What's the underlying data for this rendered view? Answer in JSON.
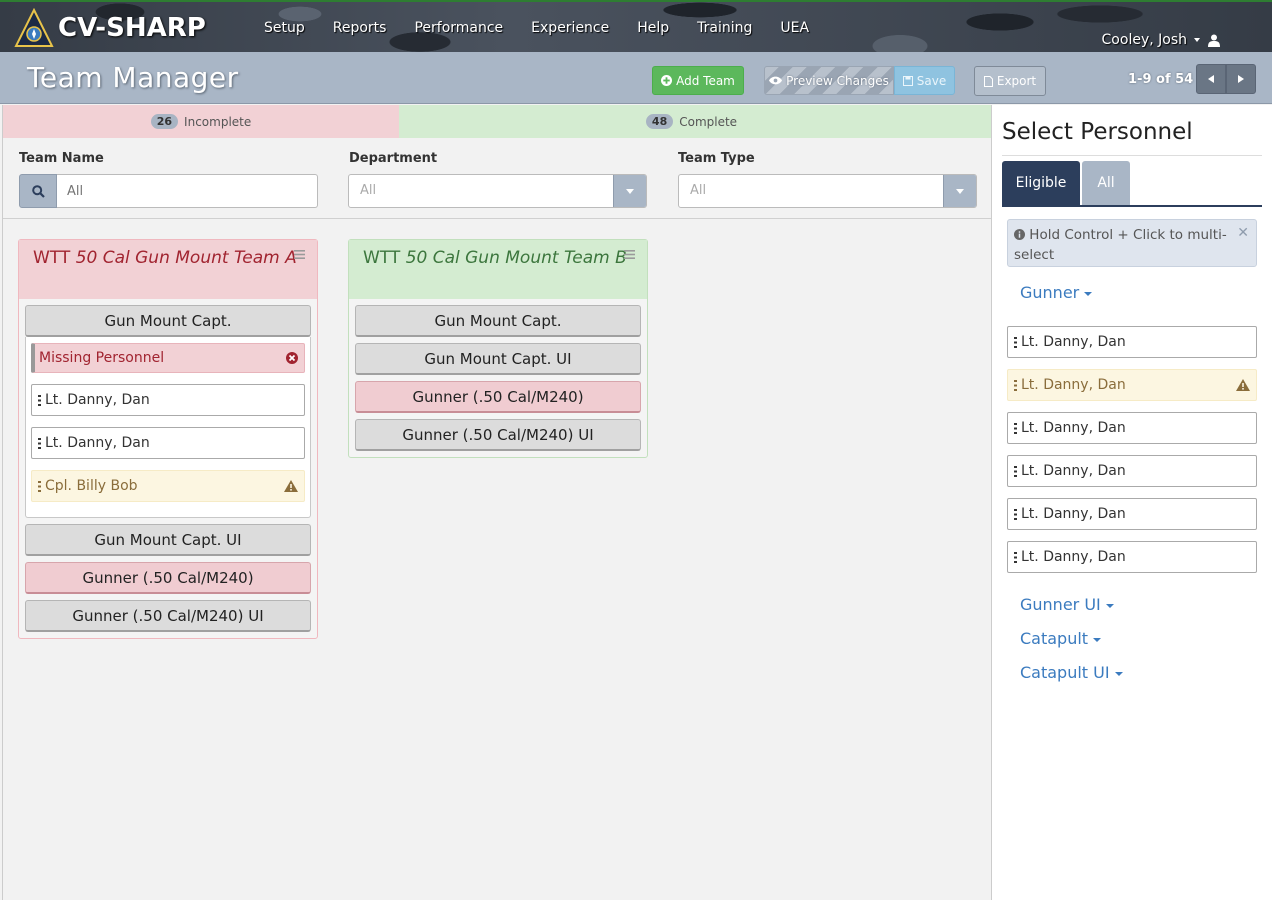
{
  "app": {
    "brand": "CV-SHARP",
    "nav": [
      "Setup",
      "Reports",
      "Performance",
      "Experience",
      "Help",
      "Training",
      "UEA"
    ],
    "user": "Cooley, Josh"
  },
  "header": {
    "title": "Team Manager",
    "add_team": "Add Team",
    "preview": "Preview Changes",
    "save": "Save",
    "export": "Export",
    "pager": "1-9 of 54"
  },
  "status": {
    "incomplete_count": "26",
    "incomplete_label": "Incomplete",
    "complete_count": "48",
    "complete_label": "Complete"
  },
  "filters": {
    "team_name_label": "Team Name",
    "team_name_placeholder": "All",
    "department_label": "Department",
    "department_value": "All",
    "team_type_label": "Team Type",
    "team_type_value": "All"
  },
  "teams": [
    {
      "title_prefix": "WTT",
      "title_italic": "50 Cal Gun Mount Team A",
      "roles": {
        "r1": "Gun Mount Capt.",
        "missing": "Missing Personnel",
        "p1": "Lt. Danny, Dan",
        "p2": "Lt. Danny, Dan",
        "p3": "Cpl. Billy Bob",
        "r2": "Gun Mount Capt. UI",
        "r3": "Gunner (.50 Cal/M240)",
        "r4": "Gunner (.50 Cal/M240) UI"
      }
    },
    {
      "title_prefix": "WTT",
      "title_italic": "50 Cal Gun Mount Team B",
      "roles": {
        "r1": "Gun Mount Capt.",
        "r2": "Gun Mount Capt. UI",
        "r3": "Gunner (.50 Cal/M240)",
        "r4": "Gunner (.50 Cal/M240) UI"
      }
    }
  ],
  "sidebar": {
    "title": "Select Personnel",
    "tab_eligible": "Eligible",
    "tab_all": "All",
    "info": "Hold Control + Click to multi-select",
    "groups": {
      "gunner": "Gunner",
      "gunner_ui": "Gunner UI",
      "catapult": "Catapult",
      "catapult_ui": "Catapult UI"
    },
    "people": [
      "Lt. Danny, Dan",
      "Lt. Danny, Dan",
      "Lt. Danny, Dan",
      "Lt. Danny, Dan",
      "Lt. Danny, Dan",
      "Lt. Danny, Dan"
    ]
  },
  "colors": {
    "incomplete": "#f2d1d5",
    "complete": "#d4ecd1",
    "navy": "#2c3e5c",
    "link": "#3b7bbf",
    "success": "#5cb85c"
  }
}
